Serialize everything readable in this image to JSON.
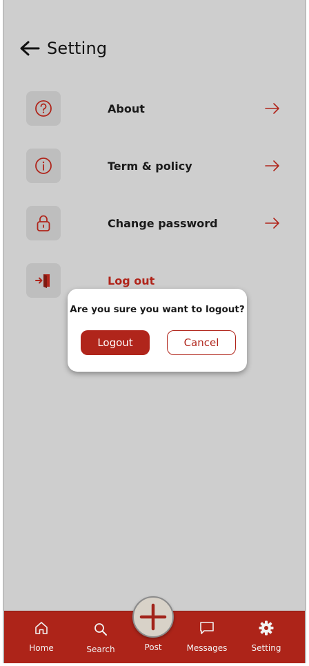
{
  "header": {
    "title": "Setting"
  },
  "settings": [
    {
      "label": "About",
      "icon": "question-icon"
    },
    {
      "label": "Term & policy",
      "icon": "info-icon"
    },
    {
      "label": "Change password",
      "icon": "lock-icon"
    },
    {
      "label": "Log out",
      "icon": "logout-icon"
    }
  ],
  "dialog": {
    "message": "Are you sure you want to logout?",
    "confirm_label": "Logout",
    "cancel_label": "Cancel"
  },
  "nav": {
    "home": "Home",
    "search": "Search",
    "post": "Post",
    "messages": "Messages",
    "setting": "Setting"
  },
  "colors": {
    "accent": "#b0251b",
    "background": "#cecece",
    "nav_bar": "#ad2419"
  }
}
